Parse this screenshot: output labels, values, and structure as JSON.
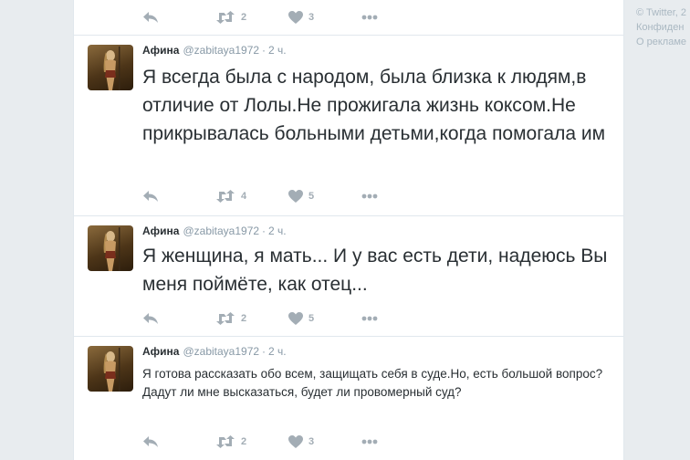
{
  "sidebar": {
    "copyright": "© Twitter, 2",
    "privacy": "Конфиден",
    "ads": "О рекламе"
  },
  "top_actions": {
    "retweets": "2",
    "likes": "3"
  },
  "tweets": [
    {
      "name": "Афина",
      "handle": "@zabitaya1972",
      "time": "2 ч.",
      "text": "Я всегда была с народом, была близка к людям,в отличие от Лолы.Не прожигала жизнь коксом.Не прикрывалась больными детьми,когда помогала им",
      "retweets": "4",
      "likes": "5"
    },
    {
      "name": "Афина",
      "handle": "@zabitaya1972",
      "time": "2 ч.",
      "text": "Я женщина, я мать... И у вас есть дети, надеюсь Вы меня поймёте, как отец...",
      "retweets": "2",
      "likes": "5"
    },
    {
      "name": "Афина",
      "handle": "@zabitaya1972",
      "time": "2 ч.",
      "text": "Я готова рассказать обо всем, защищать себя в суде.Но, есть большой вопрос? Дадут ли мне высказаться, будет ли провомерный суд?",
      "retweets": "2",
      "likes": "3"
    }
  ],
  "icons": [
    "reply-icon",
    "retweet-icon",
    "like-icon",
    "more-icon"
  ],
  "colors": {
    "text": "#292f33",
    "muted": "#8899a6",
    "action": "#a3adb5",
    "border": "#e1e8ed"
  }
}
